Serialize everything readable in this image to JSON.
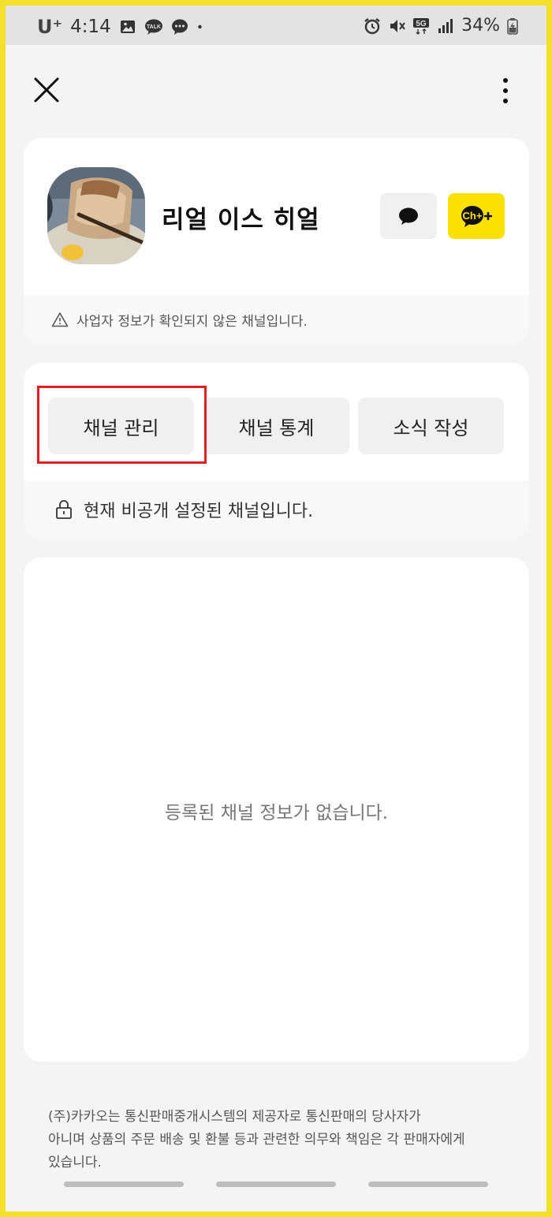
{
  "status_bar": {
    "carrier": "U⁺",
    "time": "4:14",
    "network": "5G",
    "battery": "34%"
  },
  "header": {
    "close_icon": "close-icon",
    "more_icon": "more-vertical-icon"
  },
  "profile": {
    "name": "리얼 이스 히얼",
    "chat_icon": "chat-bubble-icon",
    "chplus_label": "Ch+",
    "warning": "사업자 정보가 확인되지 않은 채널입니다."
  },
  "actions": {
    "manage": "채널 관리",
    "stats": "채널 통계",
    "post": "소식 작성",
    "private_notice": "현재 비공개 설정된 채널입니다."
  },
  "content": {
    "empty_message": "등록된 채널 정보가 없습니다."
  },
  "footer": {
    "line1": "(주)카카오는 통신판매중개시스템의 제공자로 통신판매의 당사자가",
    "line2": "아니며 상품의 주문 배송 및 환불 등과 관련한 의무와 책임은 각 판매자에게",
    "line3": "있습니다."
  },
  "colors": {
    "accent_yellow": "#FAE100",
    "highlight_red": "#E02020",
    "frame_yellow": "#F2E02A"
  }
}
